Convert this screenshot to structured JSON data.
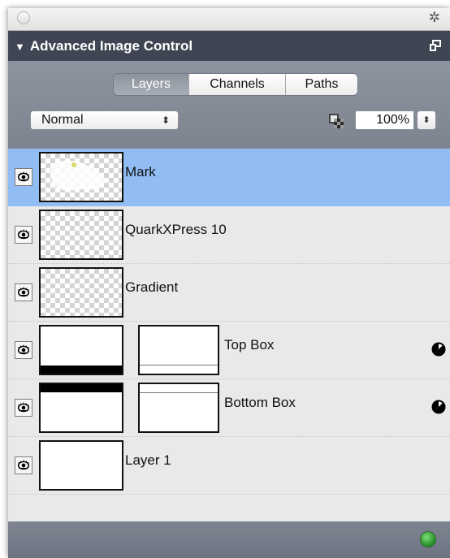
{
  "panel": {
    "title": "Advanced Image Control",
    "collapse_glyph": "▼"
  },
  "tabs": [
    {
      "label": "Layers",
      "active": true
    },
    {
      "label": "Channels",
      "active": false
    },
    {
      "label": "Paths",
      "active": false
    }
  ],
  "blend_mode": {
    "value": "Normal"
  },
  "opacity": {
    "value": "100%"
  },
  "layers": [
    {
      "name": "Mark",
      "selected": true
    },
    {
      "name": "QuarkXPress 10",
      "selected": false
    },
    {
      "name": "Gradient",
      "selected": false
    },
    {
      "name": "Top Box",
      "selected": false
    },
    {
      "name": "Bottom Box",
      "selected": false
    },
    {
      "name": "Layer 1",
      "selected": false
    }
  ],
  "colors": {
    "title_bar": "#3f4552",
    "tool_area": "#878d99",
    "selected_row": "#91bdf4",
    "status_ok": "#2fa52f"
  },
  "icons": {
    "settings": "gear-icon",
    "undock": "undock-icon",
    "visibility": "eye-icon",
    "blend": "blend-mode-icon",
    "status": "status-light-icon"
  }
}
